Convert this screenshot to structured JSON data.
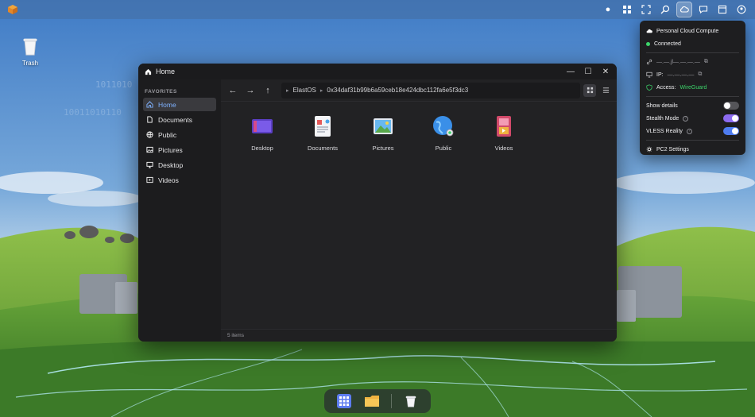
{
  "desktop": {
    "trash_label": "Trash"
  },
  "window": {
    "title": "Home",
    "minimize_glyph": "—",
    "maximize_glyph": "☐",
    "close_glyph": "✕"
  },
  "sidebar": {
    "heading": "FAVORITES",
    "items": [
      {
        "label": "Home",
        "icon": "home-icon",
        "selected": true
      },
      {
        "label": "Documents",
        "icon": "document-icon"
      },
      {
        "label": "Public",
        "icon": "globe-icon"
      },
      {
        "label": "Pictures",
        "icon": "image-icon"
      },
      {
        "label": "Desktop",
        "icon": "monitor-icon"
      },
      {
        "label": "Videos",
        "icon": "video-icon"
      }
    ]
  },
  "toolbar": {
    "back": "←",
    "forward": "→",
    "up": "↑",
    "path": [
      "ElastOS",
      "0x34daf31b99b6a59ceb18e424dbc112fa6e5f3dc3"
    ]
  },
  "files": [
    {
      "name": "Desktop",
      "icon": "desktop-folder-icon"
    },
    {
      "name": "Documents",
      "icon": "documents-folder-icon"
    },
    {
      "name": "Pictures",
      "icon": "pictures-folder-icon"
    },
    {
      "name": "Public",
      "icon": "public-folder-icon"
    },
    {
      "name": "Videos",
      "icon": "videos-folder-icon"
    }
  ],
  "status": {
    "count": "5 items"
  },
  "pcc": {
    "title": "Personal Cloud Compute",
    "connection": "Connected",
    "link_value": "—.—.jl—.—.—.—",
    "ip_label": "IP:",
    "ip_value": "—.—.—.—",
    "access_label": "Access:",
    "access_value": "WireGuard",
    "show_details": "Show details",
    "stealth_mode": "Stealth Mode",
    "vless": "VLESS Reality",
    "settings": "PC2 Settings",
    "toggles": {
      "show_details": false,
      "stealth_mode": true,
      "vless": true
    },
    "colors": {
      "green": "#3cd46a",
      "purple": "#8c6bf0",
      "blue": "#4e7cf0"
    }
  },
  "dock": {
    "items": [
      "app-grid-icon",
      "folder-icon",
      "trash-icon"
    ]
  }
}
